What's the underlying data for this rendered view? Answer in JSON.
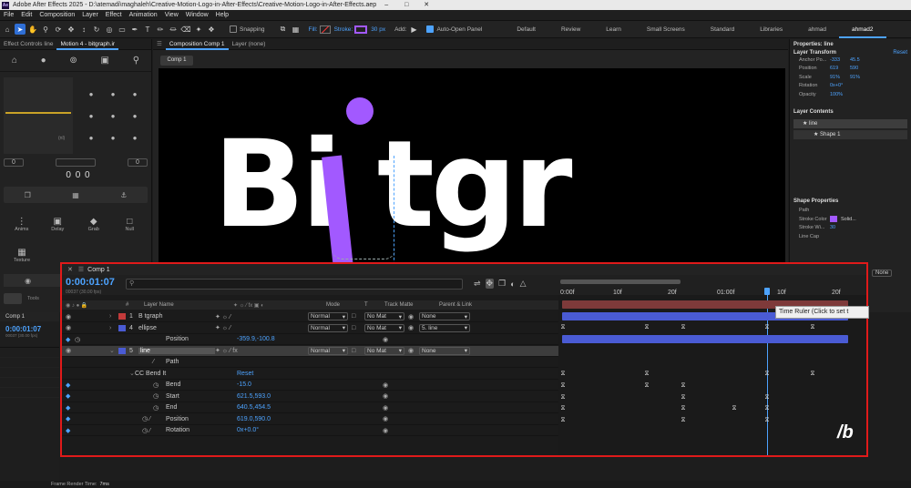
{
  "title_bar": {
    "title": "Adobe After Effects 2025 - D:\\atemadi\\maghaleh\\Creative-Motion-Logo-in-After-Effects\\Creative-Motion-Logo-in-After-Effects.aep"
  },
  "menu": [
    "File",
    "Edit",
    "Composition",
    "Layer",
    "Effect",
    "Animation",
    "View",
    "Window",
    "Help"
  ],
  "toolbar": {
    "snapping_label": "Snapping",
    "fill_label": "Fill:",
    "stroke_label": "Stroke:",
    "stroke_width": "30 px",
    "add_label": "Add:",
    "auto_open_label": "Auto-Open Panel",
    "workspaces": [
      "Default",
      "Review",
      "Learn",
      "Small Screens",
      "Standard",
      "Libraries",
      "ahmad",
      "ahmad2"
    ],
    "active_workspace": "ahmad2"
  },
  "left_panel": {
    "tab_effect_controls": "Effect Controls line",
    "tab_motion": "Motion 4 - bitgraph.ir",
    "counter": "0 0 0",
    "field_left": "0",
    "field_right": "0",
    "buttons": [
      "Anims",
      "Delay",
      "Grab",
      "Null"
    ],
    "texture_label": "Texture",
    "tools_label": "Tools"
  },
  "viewer": {
    "tab_composition": "Composition Comp 1",
    "tab_layer": "Layer (none)",
    "sub_tab": "Comp 1",
    "logo_main": "Bi tgr"
  },
  "right_panel": {
    "header": "Properties: line",
    "layer_transform": "Layer Transform",
    "reset": "Reset",
    "anchor_label": "Anchor Po...",
    "anchor_x": "-333",
    "anchor_y": "45.5",
    "position_label": "Position",
    "position_x": "619",
    "position_y": "590",
    "scale_label": "Scale",
    "scale_x": "91%",
    "scale_y": "91%",
    "rotation_label": "Rotation",
    "rotation_val": "0x+0°",
    "opacity_label": "Opacity",
    "opacity_val": "100%",
    "layer_contents": "Layer Contents",
    "contents": [
      "line",
      "Shape 1"
    ],
    "shape_properties": "Shape Properties",
    "path_label": "Path",
    "stroke_color_label": "Stroke Color",
    "stroke_style": "Solid...",
    "stroke_width_label": "Stroke Wi...",
    "stroke_width_val": "30",
    "line_cap_label": "Line Cap",
    "none_label": "None"
  },
  "bottom_left": {
    "tab": "Comp 1",
    "time": "0:00:01:07",
    "sub": "00037 (30.00 fps)"
  },
  "timeline": {
    "tab": "Comp 1",
    "time": "0:00:01:07",
    "frames": "00037 (30.00 fps)",
    "columns": {
      "hash": "#",
      "layer_name": "Layer Name",
      "mode": "Mode",
      "t": "T",
      "track_matte": "Track Matte",
      "parent": "Parent & Link"
    },
    "layers": [
      {
        "num": "1",
        "name": "B tgraph",
        "mode": "Normal",
        "matte": "No Mat",
        "parent": "None",
        "color": "#c23a3a"
      },
      {
        "num": "4",
        "name": "ellipse",
        "mode": "Normal",
        "matte": "No Mat",
        "parent": "5. line",
        "color": "#4a5bd4"
      },
      {
        "prop": "Position",
        "value": "-359.9,-100.8"
      },
      {
        "num": "5",
        "name": "line",
        "mode": "Normal",
        "matte": "No Mat",
        "parent": "None",
        "color": "#4a5bd4"
      },
      {
        "prop": "Path"
      },
      {
        "prop": "CC Bend It",
        "value": "Reset"
      },
      {
        "prop": "Bend",
        "value": "-15.0"
      },
      {
        "prop": "Start",
        "value": "621.5,593.0"
      },
      {
        "prop": "End",
        "value": "640.5,454.5"
      },
      {
        "prop": "Position",
        "value": "619.0,590.0"
      },
      {
        "prop": "Rotation",
        "value": "0x+0.0°"
      }
    ],
    "ruler": [
      "0:00f",
      "10f",
      "20f",
      "01:00f",
      "10f",
      "20f"
    ],
    "tooltip": "Time Ruler (Click to set t",
    "watermark": "/b"
  },
  "status": {
    "label": "Frame Render Time:",
    "value": "7ms"
  },
  "colors": {
    "accent": "#4da3ff",
    "purple": "#a259ff",
    "highlight_border": "#e01a1a",
    "layer_bar": "#4a5bd4"
  }
}
